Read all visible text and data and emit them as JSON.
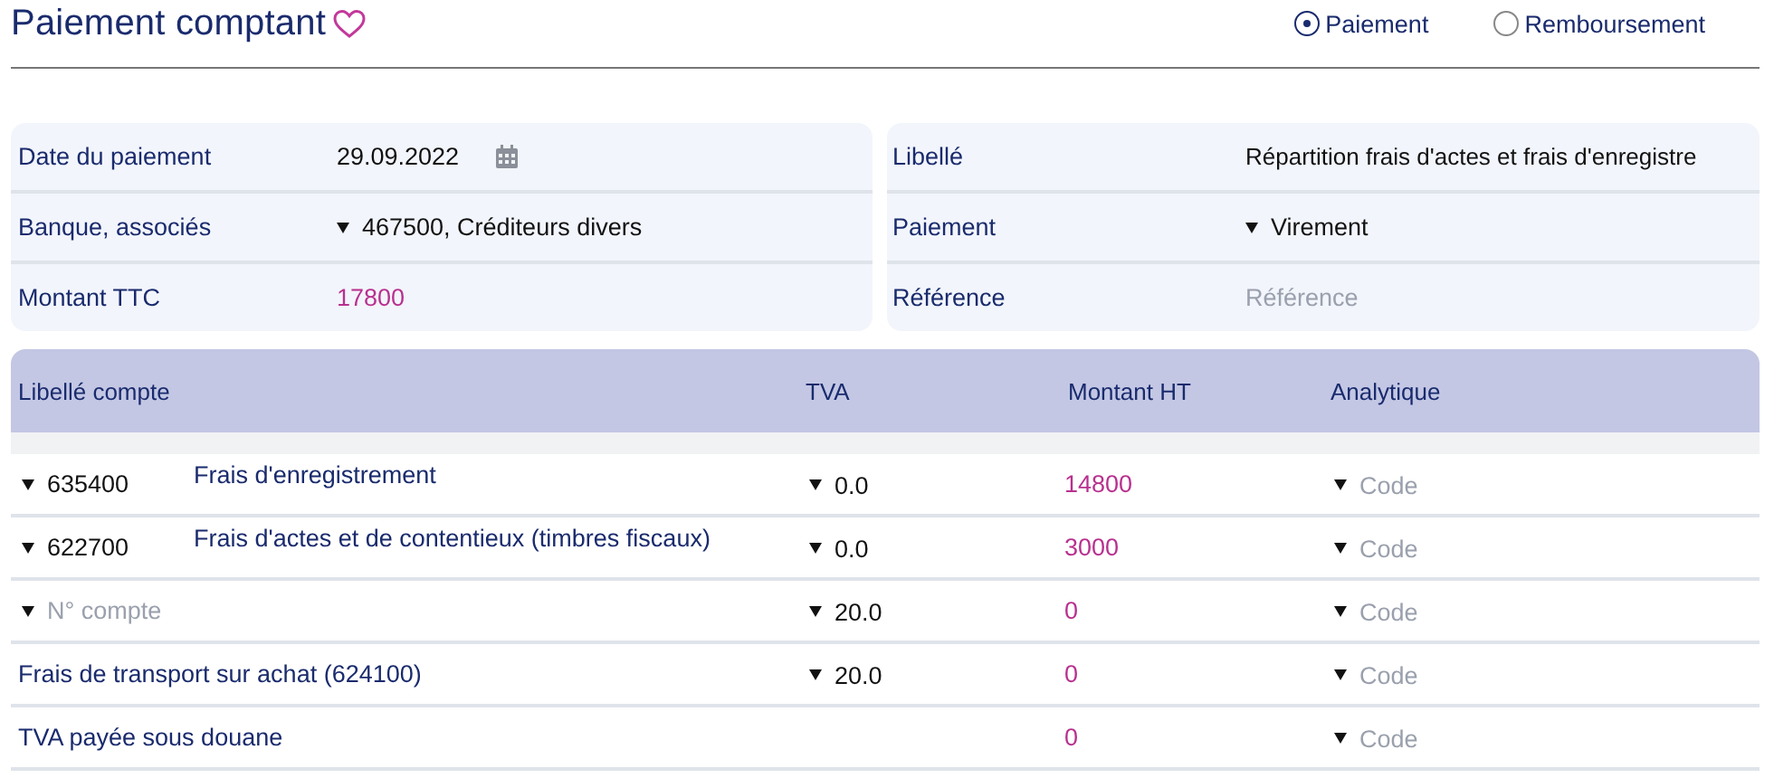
{
  "header": {
    "title": "Paiement comptant",
    "favorite": false,
    "modes": [
      {
        "label": "Paiement",
        "selected": true
      },
      {
        "label": "Remboursement",
        "selected": false
      }
    ]
  },
  "details": {
    "left": [
      {
        "label": "Date du paiement",
        "kind": "date",
        "value": "29.09.2022"
      },
      {
        "label": "Banque, associés",
        "kind": "select",
        "value": "467500, Créditeurs divers"
      },
      {
        "label": "Montant TTC",
        "kind": "amount",
        "value": "17800"
      }
    ],
    "right": [
      {
        "label": "Libellé",
        "kind": "text",
        "value": "Répartition frais d'actes et frais d'enregistre"
      },
      {
        "label": "Paiement",
        "kind": "select",
        "value": "Virement"
      },
      {
        "label": "Référence",
        "kind": "input",
        "placeholder": "Référence"
      }
    ]
  },
  "table": {
    "columns": [
      "Libellé compte",
      "TVA",
      "Montant HT",
      "Analytique"
    ],
    "rows": [
      {
        "kind": "account",
        "code": "635400",
        "label": "Frais d'enregistrement",
        "tva": "0.0",
        "amount": "14800",
        "analytic_placeholder": "Code"
      },
      {
        "kind": "account",
        "code": "622700",
        "label": "Frais d'actes et de contentieux (timbres fiscaux)",
        "tva": "0.0",
        "amount": "3000",
        "analytic_placeholder": "Code"
      },
      {
        "kind": "empty",
        "placeholder": "N° compte",
        "tva": "20.0",
        "amount": "0",
        "analytic_placeholder": "Code"
      },
      {
        "kind": "fixed",
        "label": "Frais de transport sur achat (624100)",
        "tva": "20.0",
        "amount": "0",
        "analytic_placeholder": "Code"
      },
      {
        "kind": "fixed",
        "label": "TVA payée sous douane",
        "amount": "0",
        "analytic_placeholder": "Code"
      }
    ]
  }
}
